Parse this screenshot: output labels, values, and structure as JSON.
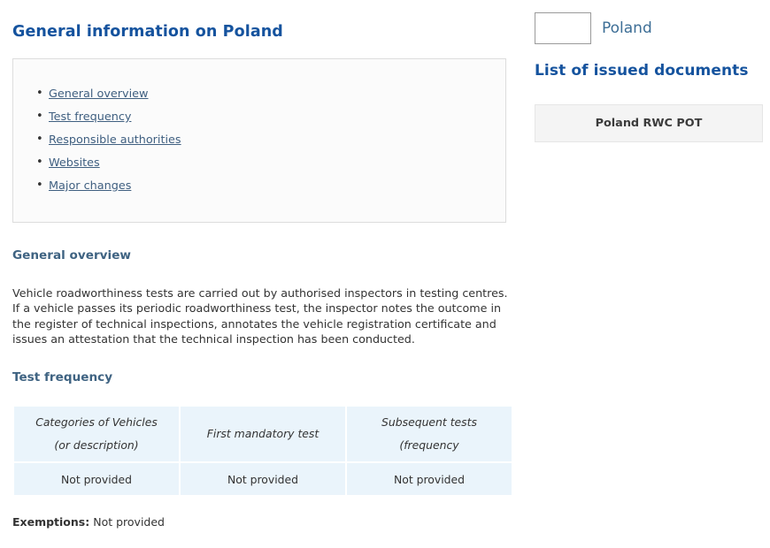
{
  "page": {
    "title": "General information on Poland"
  },
  "toc": {
    "items": [
      {
        "label": "General overview"
      },
      {
        "label": "Test frequency"
      },
      {
        "label": "Responsible authorities"
      },
      {
        "label": "Websites"
      },
      {
        "label": "Major changes"
      }
    ]
  },
  "sections": {
    "general_overview": {
      "heading": "General overview",
      "paragraph": "Vehicle roadworthiness tests are carried out by authorised inspectors in testing centres. If a vehicle passes its periodic roadworthiness test, the inspector notes the outcome in the register of technical inspections, annotates the vehicle registration certificate and issues an attestation that the technical inspection has been conducted."
    },
    "test_frequency": {
      "heading": "Test frequency",
      "table": {
        "headers": [
          {
            "line1": "Categories of Vehicles",
            "line2": "(or description)"
          },
          {
            "line1": "First mandatory test",
            "line2": ""
          },
          {
            "line1": "Subsequent tests (frequency",
            "line2": ""
          }
        ],
        "rows": [
          [
            "Not provided",
            "Not provided",
            "Not provided"
          ]
        ]
      },
      "exemptions_label": "Exemptions:",
      "exemptions_value": "Not provided"
    }
  },
  "country": {
    "name": "Poland",
    "flag_icon": "poland-flag-icon",
    "flag_colors": {
      "top": "#ffffff",
      "bottom": "#e8120c"
    }
  },
  "documents": {
    "heading": "List of issued documents",
    "items": [
      {
        "label": "Poland RWC POT"
      }
    ]
  },
  "colors": {
    "title_blue": "#15539e",
    "section_blue": "#3f6382",
    "link_blue": "#3f5f80",
    "country_blue": "#3d6e96",
    "table_cell_bg": "#eaf4fb",
    "toc_box_bg": "#fbfbfb",
    "card_bg": "#f4f4f4"
  }
}
